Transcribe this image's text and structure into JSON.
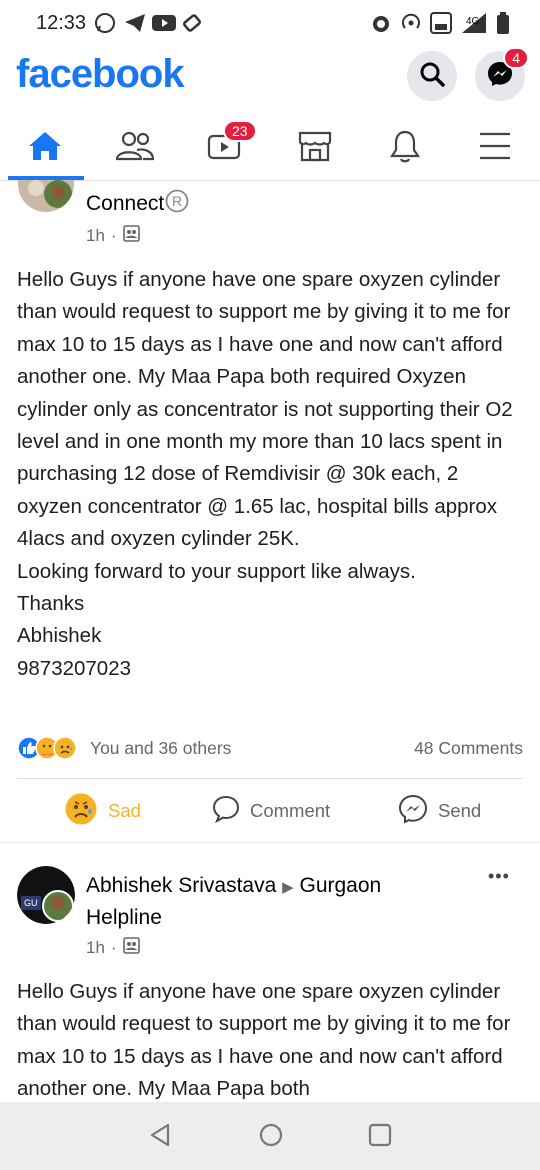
{
  "status_bar": {
    "time": "12:33",
    "network": "4G"
  },
  "header": {
    "logo": "facebook",
    "search_icon": "search-icon",
    "messenger_icon": "messenger-icon",
    "messenger_badge": "4"
  },
  "nav": {
    "tabs": [
      {
        "name": "home",
        "icon": "home-icon",
        "active": true
      },
      {
        "name": "friends",
        "icon": "friends-icon"
      },
      {
        "name": "watch",
        "icon": "watch-icon",
        "badge": "23"
      },
      {
        "name": "marketplace",
        "icon": "marketplace-icon"
      },
      {
        "name": "notifications",
        "icon": "bell-icon"
      },
      {
        "name": "menu",
        "icon": "menu-icon"
      }
    ]
  },
  "post1": {
    "group_name_partial": "Connect",
    "time": "1h",
    "text": "Hello Guys if anyone have one spare oxyzen cylinder than would request to support me by giving it to me for max 10 to 15 days as I have one and now can't afford another one. My Maa Papa both required Oxyzen cylinder only as concentrator is not supporting their O2 level and in one month my more than 10 lacs spent in purchasing 12 dose of Remdivisir @ 30k each, 2 oxyzen concentrator @ 1.65 lac, hospital bills approx 4lacs and oxyzen cylinder 25K.\nLooking forward to your support like always.\nThanks\nAbhishek\n9873207023",
    "reactions_text": "You and 36 others",
    "comments_text": "48 Comments",
    "actions": {
      "sad": "Sad",
      "comment": "Comment",
      "send": "Send"
    }
  },
  "post2": {
    "author": "Abhishek Srivastava",
    "arrow": "▶",
    "group": "Gurgaon",
    "group_line2": "Helpline",
    "time": "1h",
    "more": "•••",
    "text": "Hello Guys if anyone have one spare oxyzen cylinder than would request to support me by giving it to me for max 10 to 15 days as I have one and now can't afford another one. My Maa Papa both"
  },
  "colors": {
    "brand": "#1877f2",
    "sad": "#f7b125",
    "badge": "#e41e3f"
  }
}
